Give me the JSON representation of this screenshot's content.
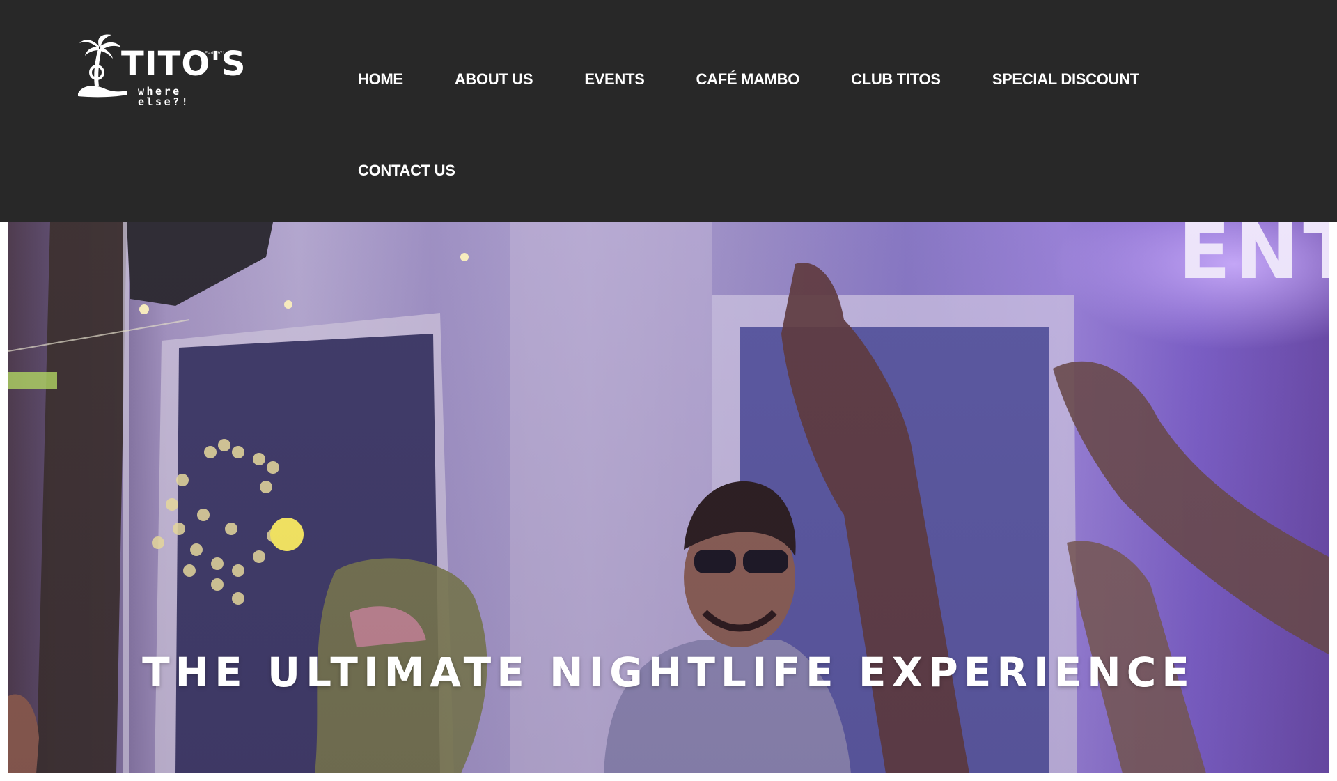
{
  "logo": {
    "wordmark": "TITO'S",
    "tagline": "where else?!",
    "established": "Estd. 1971",
    "icon": "palm-tree-icon"
  },
  "nav": {
    "items": [
      {
        "label": "HOME"
      },
      {
        "label": "ABOUT US"
      },
      {
        "label": "EVENTS"
      },
      {
        "label": "CAFÉ MAMBO"
      },
      {
        "label": "CLUB TITOS"
      },
      {
        "label": "SPECIAL DISCOUNT"
      },
      {
        "label": "CONTACT US"
      }
    ]
  },
  "hero": {
    "title": "THE ULTIMATE NIGHTLIFE EXPERIENCE",
    "image": "dj-nightclub-crowd-photo"
  },
  "colors": {
    "header_bg": "#282828",
    "nav_text": "#ffffff",
    "hero_tint": "#9a8cc8",
    "hero_title": "#ffffff"
  }
}
